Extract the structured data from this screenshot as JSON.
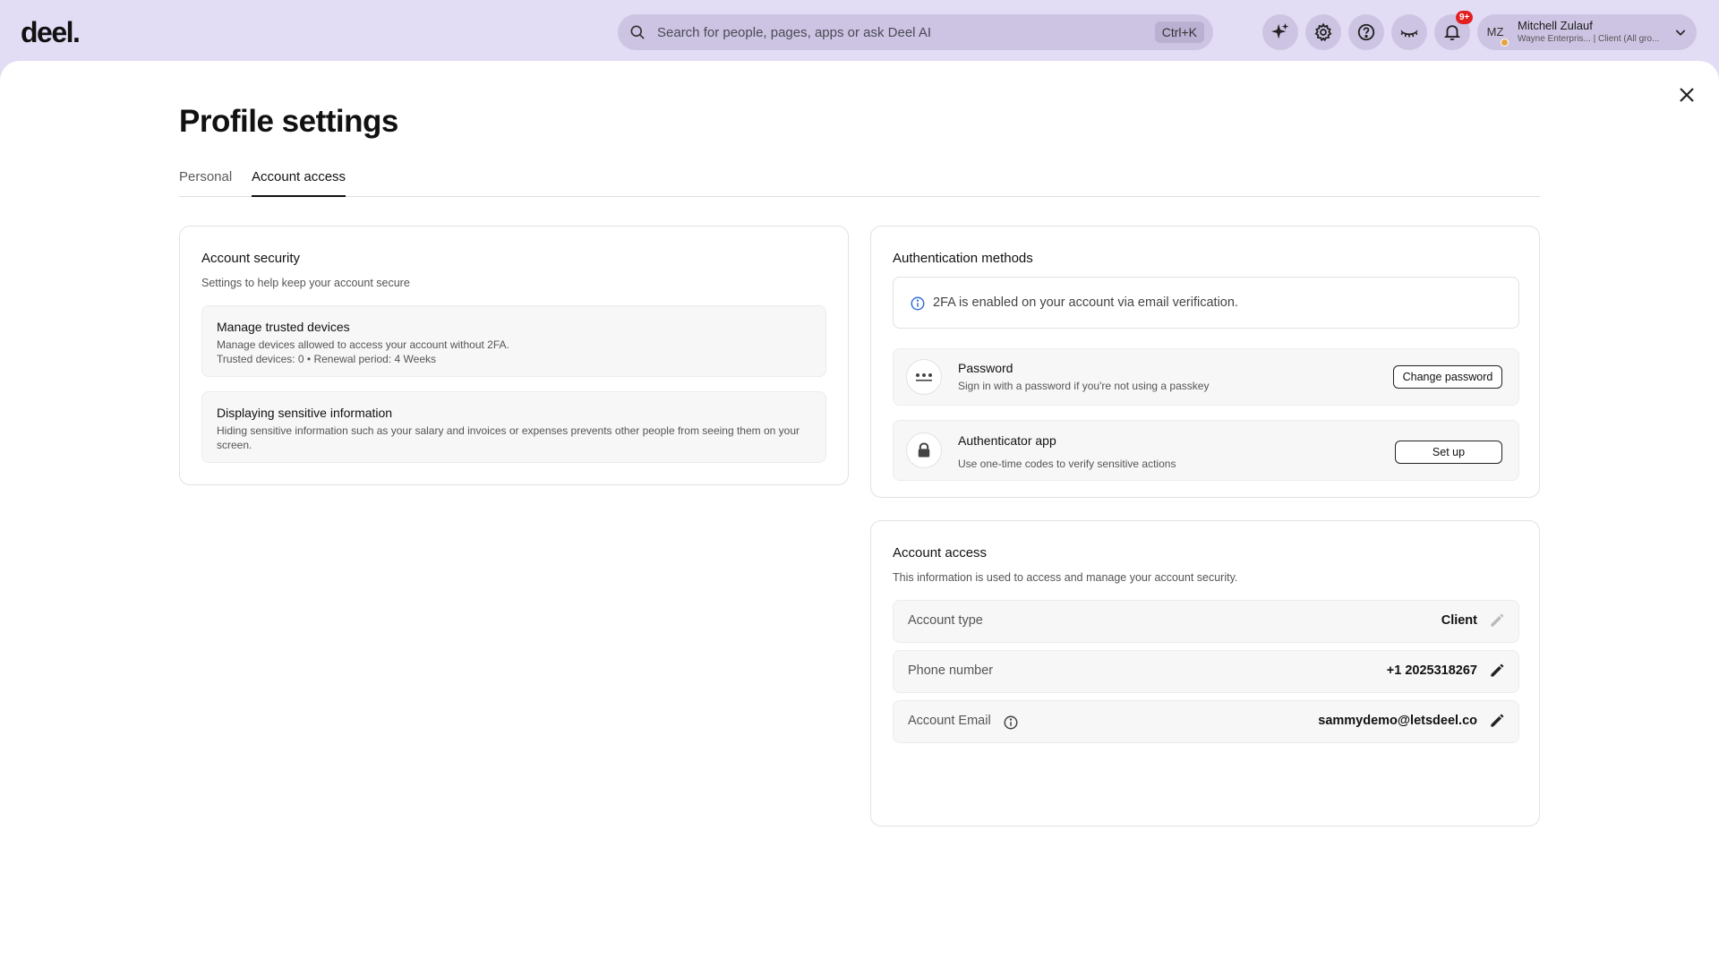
{
  "header": {
    "logo": "deel.",
    "search_placeholder": "Search for people, pages, apps or ask Deel AI",
    "search_shortcut": "Ctrl+K",
    "notification_badge": "9+",
    "user": {
      "initials": "MZ",
      "name": "Mitchell Zulauf",
      "org": "Wayne Enterpris... | Client (All gro..."
    }
  },
  "page": {
    "title": "Profile settings",
    "tabs": [
      {
        "label": "Personal",
        "active": false
      },
      {
        "label": "Account access",
        "active": true
      }
    ]
  },
  "security": {
    "title": "Account security",
    "subtitle": "Settings to help keep your account secure",
    "trusted": {
      "title": "Manage trusted devices",
      "desc": "Manage devices allowed to access your account without 2FA.",
      "meta": "Trusted devices: 0 • Renewal period: 4 Weeks"
    },
    "sensitive": {
      "title": "Displaying sensitive information",
      "desc": "Hiding sensitive information such as your salary and invoices or expenses prevents other people from seeing them on your screen."
    }
  },
  "auth": {
    "title": "Authentication methods",
    "notice": "2FA is enabled on your account via email verification.",
    "password": {
      "title": "Password",
      "desc": "Sign in with a password if you're not using a passkey",
      "button": "Change password"
    },
    "authenticator": {
      "title": "Authenticator app",
      "desc": "Use one-time codes to verify sensitive actions",
      "button": "Set up"
    }
  },
  "access": {
    "title": "Account access",
    "subtitle": "This information is used to access and manage your account security.",
    "account_type": {
      "label": "Account type",
      "value": "Client"
    },
    "phone": {
      "label": "Phone number",
      "value": "+1 2025318267"
    },
    "email": {
      "label": "Account Email",
      "value": "sammydemo@letsdeel.co"
    }
  },
  "colors": {
    "header_bg": "#e3dcf5",
    "pill_bg": "#cdc4e3",
    "badge": "#e32020",
    "info_icon": "#3a6fd8"
  }
}
